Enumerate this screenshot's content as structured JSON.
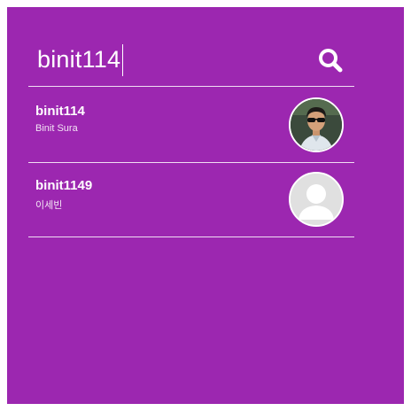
{
  "search": {
    "value": "binit114",
    "icon": "search-icon"
  },
  "results": [
    {
      "username": "binit114",
      "fullname": "Binit Sura",
      "avatar": "profile-photo"
    },
    {
      "username": "binit1149",
      "fullname": "이세빈",
      "avatar": "default-avatar-icon"
    }
  ],
  "colors": {
    "background": "#9c27b0",
    "text": "#ffffff",
    "divider": "#ffffff",
    "default_avatar": "#e0e0e0"
  }
}
